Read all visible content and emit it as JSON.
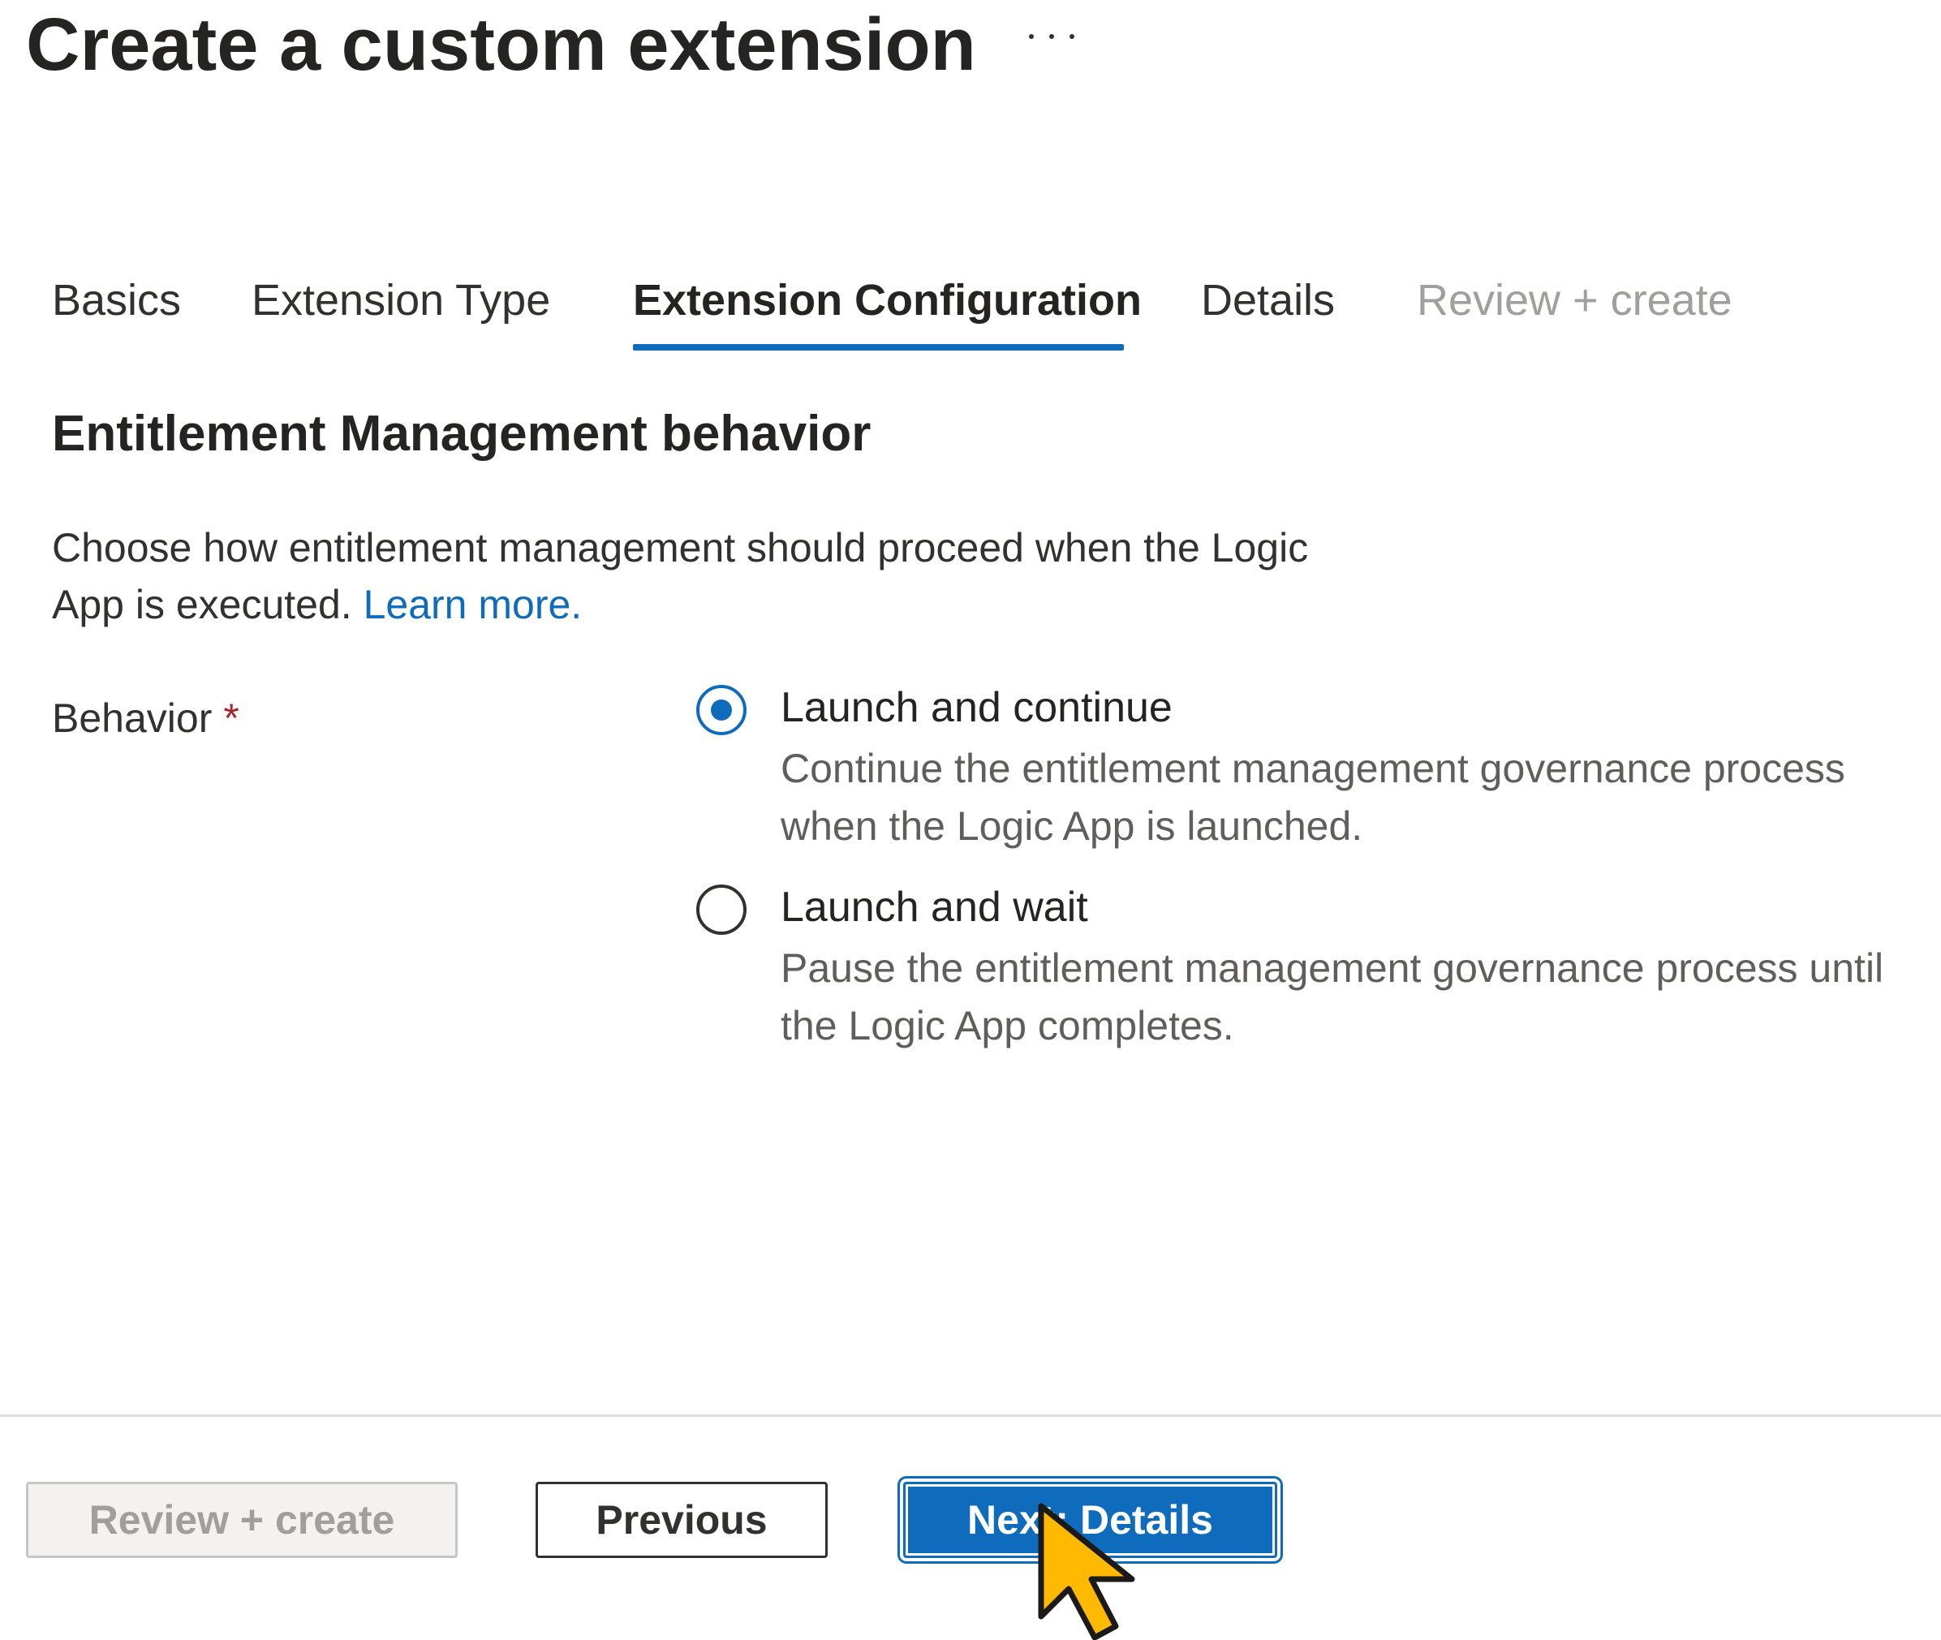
{
  "page": {
    "title": "Create a custom extension",
    "more_icon": "more-horizontal-icon"
  },
  "tabs": [
    {
      "label": "Basics",
      "state": "normal"
    },
    {
      "label": "Extension Type",
      "state": "normal"
    },
    {
      "label": "Extension Configuration",
      "state": "active"
    },
    {
      "label": "Details",
      "state": "normal"
    },
    {
      "label": "Review + create",
      "state": "disabled"
    }
  ],
  "section": {
    "heading": "Entitlement Management behavior",
    "description": "Choose how entitlement management should proceed when the Logic App is executed.",
    "learn_more": "Learn more."
  },
  "behavior": {
    "label": "Behavior",
    "required_mark": "*",
    "selected": "Launch and continue",
    "options": [
      {
        "label": "Launch and continue",
        "description": "Continue the entitlement management governance process when the Logic App is launched.",
        "checked": true
      },
      {
        "label": "Launch and wait",
        "description": "Pause the entitlement management governance process until the Logic App completes.",
        "checked": false
      }
    ]
  },
  "footer": {
    "review_create_label": "Review + create",
    "previous_label": "Previous",
    "next_label": "Next: Details"
  },
  "cursor": {
    "icon": "mouse-pointer-icon",
    "color": "#ffb900"
  },
  "colors": {
    "accent": "#0f6cbd",
    "required": "#a4262c",
    "disabled_text": "#a19f9d"
  }
}
